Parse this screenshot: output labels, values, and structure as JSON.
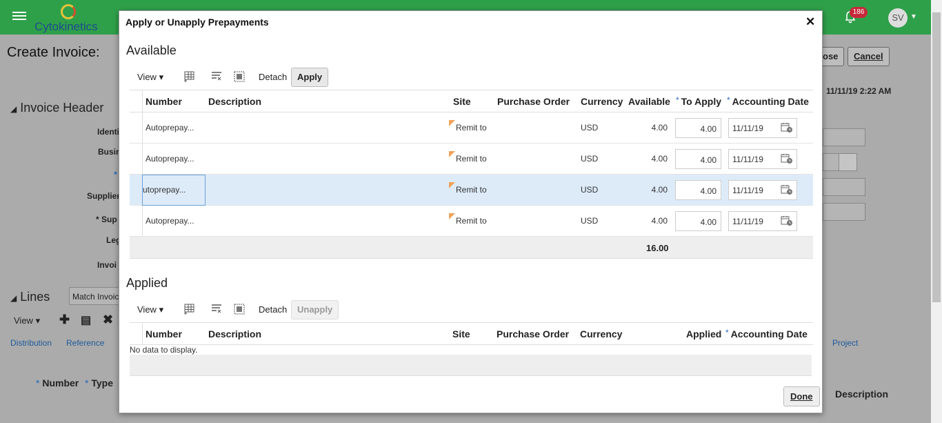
{
  "app": {
    "brand": "Cytokinetics",
    "notification_count": "186",
    "user_initials": "SV"
  },
  "background": {
    "page_title": "Create Invoice:",
    "save_close_partial": "ose",
    "cancel_label": "Cancel",
    "timestamp": "11/11/19 2:22 AM",
    "invoice_header": "Invoice Header",
    "labels": [
      "Identi",
      "Busin",
      "*",
      "Supplier",
      "* Sup",
      "Leg",
      "Invoi"
    ],
    "lines_header": "Lines",
    "match_invoice": "Match Invoic",
    "view_label": "View",
    "tabs": [
      "Distribution",
      "Reference",
      "Project"
    ],
    "col_number": "Number",
    "col_type": "Type",
    "col_description": "Description"
  },
  "dialog": {
    "title": "Apply or Unapply Prepayments",
    "close_glyph": "✕",
    "available": {
      "section_title": "Available",
      "view_label": "View",
      "detach_label": "Detach",
      "apply_label": "Apply",
      "columns": {
        "number": "Number",
        "description": "Description",
        "site": "Site",
        "purchase_order": "Purchase Order",
        "currency": "Currency",
        "available": "Available",
        "to_apply": "To Apply",
        "accounting_date": "Accounting Date"
      },
      "rows": [
        {
          "number": "Autoprepay...",
          "description": "",
          "site": "Remit to",
          "po": "",
          "currency": "USD",
          "available": "4.00",
          "to_apply": "4.00",
          "date": "11/11/19"
        },
        {
          "number": "Autoprepay...",
          "description": "",
          "site": "Remit to",
          "po": "",
          "currency": "USD",
          "available": "4.00",
          "to_apply": "4.00",
          "date": "11/11/19"
        },
        {
          "number": "utoprepay...",
          "description": "",
          "site": "Remit to",
          "po": "",
          "currency": "USD",
          "available": "4.00",
          "to_apply": "4.00",
          "date": "11/11/19"
        },
        {
          "number": "Autoprepay...",
          "description": "",
          "site": "Remit to",
          "po": "",
          "currency": "USD",
          "available": "4.00",
          "to_apply": "4.00",
          "date": "11/11/19"
        }
      ],
      "total": "16.00"
    },
    "applied": {
      "section_title": "Applied",
      "view_label": "View",
      "detach_label": "Detach",
      "unapply_label": "Unapply",
      "columns": {
        "number": "Number",
        "description": "Description",
        "site": "Site",
        "purchase_order": "Purchase Order",
        "currency": "Currency",
        "applied": "Applied",
        "accounting_date": "Accounting Date"
      },
      "empty_message": "No data to display."
    },
    "done_label": "Done"
  },
  "colors": {
    "header_green": "#2fa04a",
    "selected_row": "#ddebf9",
    "required_star": "#2a67b8",
    "flag_orange": "#f0a35a"
  }
}
